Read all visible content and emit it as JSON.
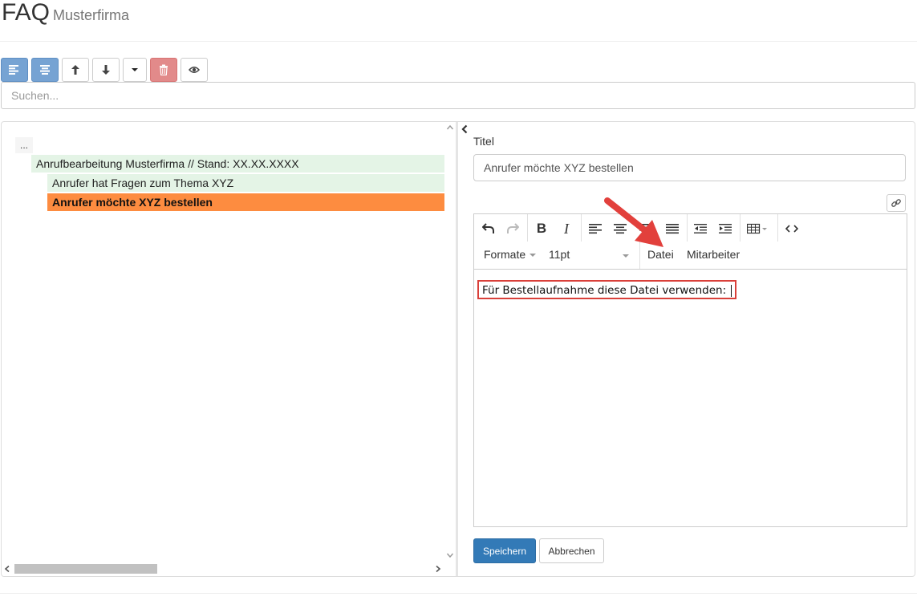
{
  "header": {
    "title": "FAQ",
    "subtitle": "Musterfirma"
  },
  "toolbar": {
    "buttons": [
      {
        "icon": "align-left-icon"
      },
      {
        "icon": "align-center-icon"
      },
      {
        "icon": "arrow-up-icon"
      },
      {
        "icon": "arrow-down-icon"
      },
      {
        "icon": "caret-down-icon"
      },
      {
        "icon": "trash-icon"
      },
      {
        "icon": "eye-icon"
      }
    ]
  },
  "search": {
    "placeholder": "Suchen..."
  },
  "tree": {
    "root": "...",
    "nodes": [
      {
        "label": "Anrufbearbeitung Musterfirma // Stand: XX.XX.XXXX",
        "level": 1
      },
      {
        "label": "Anrufer hat Fragen zum Thema XYZ",
        "level": 2
      },
      {
        "label": "Anrufer möchte XYZ bestellen",
        "level": 2,
        "active": true
      }
    ]
  },
  "editor_form": {
    "title_label": "Titel",
    "title_value": "Anrufer möchte XYZ bestellen",
    "menu": {
      "formats": "Formate",
      "font_size": "11pt",
      "file": "Datei",
      "staff": "Mitarbeiter"
    },
    "content": "Für Bestellaufnahme diese Datei verwenden:",
    "save_label": "Speichern",
    "cancel_label": "Abbrechen"
  },
  "colors": {
    "primary": "#337ab7",
    "active_node": "#fd8c40",
    "node_bg": "#e4f4e6",
    "danger": "#e28a8a",
    "annotation": "#d9403a"
  }
}
